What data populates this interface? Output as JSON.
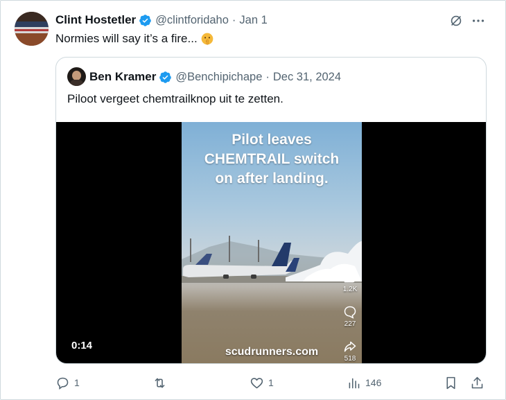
{
  "tweet": {
    "author_name": "Clint Hostetler",
    "author_handle": "@clintforidaho",
    "separator": "·",
    "date": "Jan 1",
    "text": "Normies will say it’s a fire...",
    "emoji": "shushing-face",
    "verified": true
  },
  "quote": {
    "author_name": "Ben Kramer",
    "author_handle": "@Benchipichape",
    "separator": "·",
    "date": "Dec 31, 2024",
    "text": "Piloot vergeet chemtrailknop uit te zetten.",
    "verified": true
  },
  "video": {
    "overlay_line1": "Pilot leaves",
    "overlay_line2": "CHEMTRAIL switch",
    "overlay_line3": "on after landing.",
    "watermark": "scudrunners.com",
    "timestamp": "0:14",
    "likes": "1.2K",
    "comments": "227",
    "shares": "518"
  },
  "actions": {
    "replies": "1",
    "reposts": "",
    "likes": "1",
    "views": "146"
  },
  "colors": {
    "text_primary": "#0f1419",
    "text_secondary": "#536471",
    "verified_blue": "#1d9bf0",
    "border": "#cfd9de"
  },
  "icons": [
    "verified-badge-icon",
    "grok-icon",
    "more-icon",
    "reply-icon",
    "repost-icon",
    "like-icon",
    "views-icon",
    "bookmark-icon",
    "share-icon",
    "thumbs-up-icon",
    "comment-bubble-icon",
    "share-arrow-icon"
  ]
}
